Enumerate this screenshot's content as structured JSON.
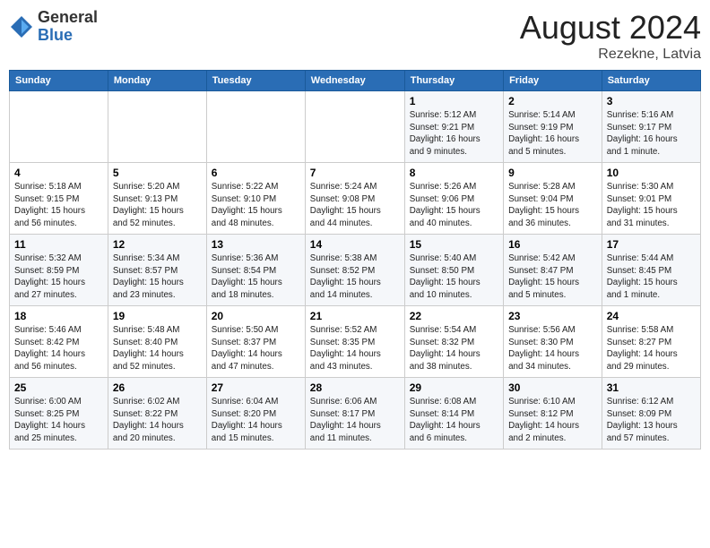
{
  "logo": {
    "general": "General",
    "blue": "Blue"
  },
  "title": "August 2024",
  "subtitle": "Rezekne, Latvia",
  "days_of_week": [
    "Sunday",
    "Monday",
    "Tuesday",
    "Wednesday",
    "Thursday",
    "Friday",
    "Saturday"
  ],
  "weeks": [
    [
      {
        "day": "",
        "info": ""
      },
      {
        "day": "",
        "info": ""
      },
      {
        "day": "",
        "info": ""
      },
      {
        "day": "",
        "info": ""
      },
      {
        "day": "1",
        "info": "Sunrise: 5:12 AM\nSunset: 9:21 PM\nDaylight: 16 hours\nand 9 minutes."
      },
      {
        "day": "2",
        "info": "Sunrise: 5:14 AM\nSunset: 9:19 PM\nDaylight: 16 hours\nand 5 minutes."
      },
      {
        "day": "3",
        "info": "Sunrise: 5:16 AM\nSunset: 9:17 PM\nDaylight: 16 hours\nand 1 minute."
      }
    ],
    [
      {
        "day": "4",
        "info": "Sunrise: 5:18 AM\nSunset: 9:15 PM\nDaylight: 15 hours\nand 56 minutes."
      },
      {
        "day": "5",
        "info": "Sunrise: 5:20 AM\nSunset: 9:13 PM\nDaylight: 15 hours\nand 52 minutes."
      },
      {
        "day": "6",
        "info": "Sunrise: 5:22 AM\nSunset: 9:10 PM\nDaylight: 15 hours\nand 48 minutes."
      },
      {
        "day": "7",
        "info": "Sunrise: 5:24 AM\nSunset: 9:08 PM\nDaylight: 15 hours\nand 44 minutes."
      },
      {
        "day": "8",
        "info": "Sunrise: 5:26 AM\nSunset: 9:06 PM\nDaylight: 15 hours\nand 40 minutes."
      },
      {
        "day": "9",
        "info": "Sunrise: 5:28 AM\nSunset: 9:04 PM\nDaylight: 15 hours\nand 36 minutes."
      },
      {
        "day": "10",
        "info": "Sunrise: 5:30 AM\nSunset: 9:01 PM\nDaylight: 15 hours\nand 31 minutes."
      }
    ],
    [
      {
        "day": "11",
        "info": "Sunrise: 5:32 AM\nSunset: 8:59 PM\nDaylight: 15 hours\nand 27 minutes."
      },
      {
        "day": "12",
        "info": "Sunrise: 5:34 AM\nSunset: 8:57 PM\nDaylight: 15 hours\nand 23 minutes."
      },
      {
        "day": "13",
        "info": "Sunrise: 5:36 AM\nSunset: 8:54 PM\nDaylight: 15 hours\nand 18 minutes."
      },
      {
        "day": "14",
        "info": "Sunrise: 5:38 AM\nSunset: 8:52 PM\nDaylight: 15 hours\nand 14 minutes."
      },
      {
        "day": "15",
        "info": "Sunrise: 5:40 AM\nSunset: 8:50 PM\nDaylight: 15 hours\nand 10 minutes."
      },
      {
        "day": "16",
        "info": "Sunrise: 5:42 AM\nSunset: 8:47 PM\nDaylight: 15 hours\nand 5 minutes."
      },
      {
        "day": "17",
        "info": "Sunrise: 5:44 AM\nSunset: 8:45 PM\nDaylight: 15 hours\nand 1 minute."
      }
    ],
    [
      {
        "day": "18",
        "info": "Sunrise: 5:46 AM\nSunset: 8:42 PM\nDaylight: 14 hours\nand 56 minutes."
      },
      {
        "day": "19",
        "info": "Sunrise: 5:48 AM\nSunset: 8:40 PM\nDaylight: 14 hours\nand 52 minutes."
      },
      {
        "day": "20",
        "info": "Sunrise: 5:50 AM\nSunset: 8:37 PM\nDaylight: 14 hours\nand 47 minutes."
      },
      {
        "day": "21",
        "info": "Sunrise: 5:52 AM\nSunset: 8:35 PM\nDaylight: 14 hours\nand 43 minutes."
      },
      {
        "day": "22",
        "info": "Sunrise: 5:54 AM\nSunset: 8:32 PM\nDaylight: 14 hours\nand 38 minutes."
      },
      {
        "day": "23",
        "info": "Sunrise: 5:56 AM\nSunset: 8:30 PM\nDaylight: 14 hours\nand 34 minutes."
      },
      {
        "day": "24",
        "info": "Sunrise: 5:58 AM\nSunset: 8:27 PM\nDaylight: 14 hours\nand 29 minutes."
      }
    ],
    [
      {
        "day": "25",
        "info": "Sunrise: 6:00 AM\nSunset: 8:25 PM\nDaylight: 14 hours\nand 25 minutes."
      },
      {
        "day": "26",
        "info": "Sunrise: 6:02 AM\nSunset: 8:22 PM\nDaylight: 14 hours\nand 20 minutes."
      },
      {
        "day": "27",
        "info": "Sunrise: 6:04 AM\nSunset: 8:20 PM\nDaylight: 14 hours\nand 15 minutes."
      },
      {
        "day": "28",
        "info": "Sunrise: 6:06 AM\nSunset: 8:17 PM\nDaylight: 14 hours\nand 11 minutes."
      },
      {
        "day": "29",
        "info": "Sunrise: 6:08 AM\nSunset: 8:14 PM\nDaylight: 14 hours\nand 6 minutes."
      },
      {
        "day": "30",
        "info": "Sunrise: 6:10 AM\nSunset: 8:12 PM\nDaylight: 14 hours\nand 2 minutes."
      },
      {
        "day": "31",
        "info": "Sunrise: 6:12 AM\nSunset: 8:09 PM\nDaylight: 13 hours\nand 57 minutes."
      }
    ]
  ]
}
